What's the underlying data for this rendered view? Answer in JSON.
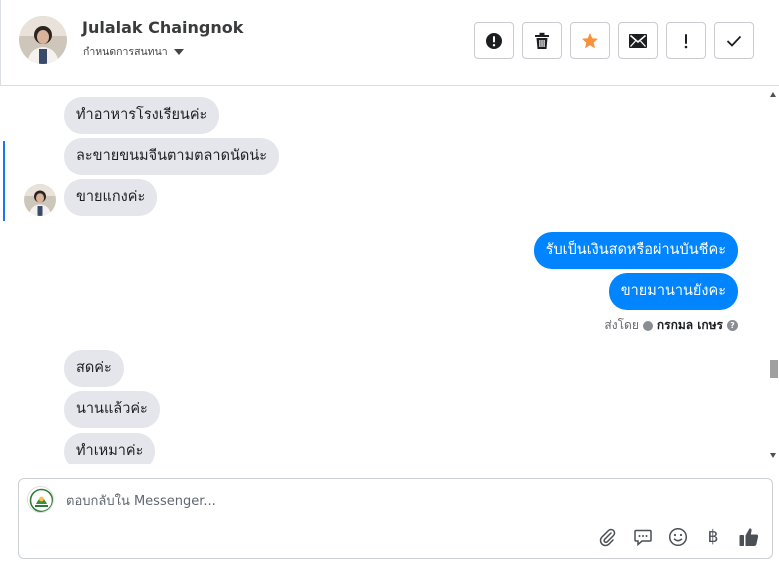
{
  "header": {
    "contact_name": "Julalak Chaingnok",
    "assign_label": "กำหนดการสนทนา",
    "actions": [
      {
        "name": "report-spam-button",
        "icon": "exclamation-circle-icon"
      },
      {
        "name": "delete-button",
        "icon": "trash-icon"
      },
      {
        "name": "star-button",
        "icon": "star-icon",
        "color": "#f7923a"
      },
      {
        "name": "mark-unread-button",
        "icon": "envelope-icon"
      },
      {
        "name": "follow-up-button",
        "icon": "exclamation-icon"
      },
      {
        "name": "mark-done-button",
        "icon": "checkmark-icon"
      }
    ]
  },
  "messages": {
    "in1": "ทำอาหารโรงเรียนค่ะ",
    "in2": "ละขายขนมจีนตามตลาดนัดน่ะ",
    "in3": "ขายแกงค่ะ",
    "out1": "รับเป็นเงินสดหรือผ่านบันชีคะ",
    "out2": "ขายมานานยังคะ",
    "in4": "สดค่ะ",
    "in5": "นานแล้วค่ะ",
    "in6": "ทำเหมาค่ะ"
  },
  "sent_by": {
    "label": "ส่งโดย",
    "name": "กรกมล เกษร"
  },
  "composer": {
    "placeholder": "ตอบกลับใน Messenger...",
    "currency_symbol": "฿",
    "icons": [
      "paperclip-icon",
      "saved-reply-icon",
      "emoji-icon",
      "baht-icon",
      "thumbs-up-icon"
    ]
  },
  "colors": {
    "outgoing_bubble": "#0084ff",
    "incoming_bubble": "#e4e6eb",
    "focus_bar": "#1877f2",
    "star": "#f7923a"
  }
}
